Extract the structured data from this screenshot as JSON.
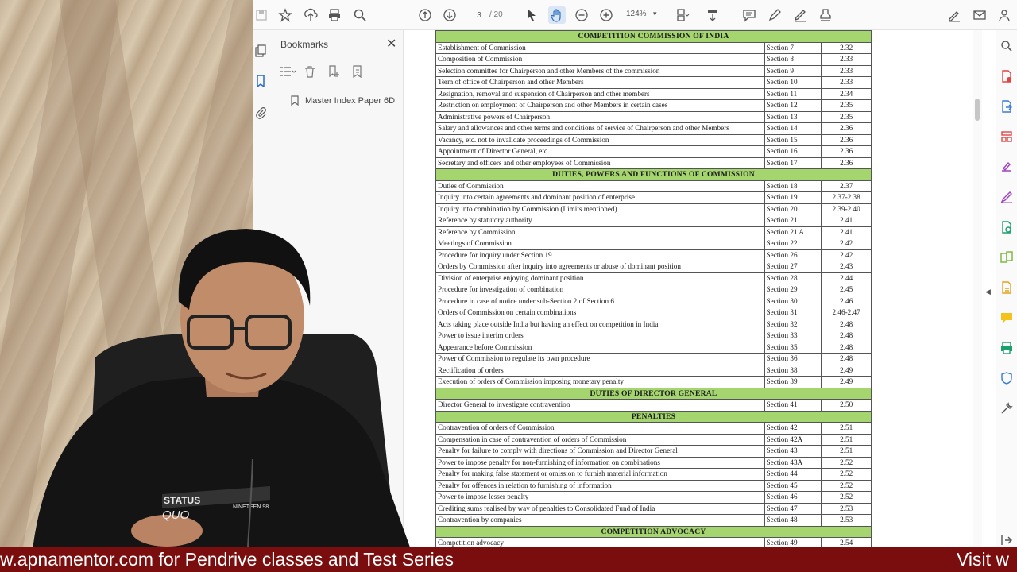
{
  "toolbar": {
    "page_current": "3",
    "page_total": "/ 20",
    "zoom": "124%"
  },
  "bookmarks": {
    "title": "Bookmarks",
    "close": "✕",
    "item": "Master Index Paper 6D"
  },
  "index": {
    "rows": [
      {
        "type": "head",
        "title": "COMPETITION COMMISSION OF INDIA"
      },
      {
        "topic": "Establishment of Commission",
        "section": "Section 7",
        "page": "2.32"
      },
      {
        "topic": "Composition of Commission",
        "section": "Section 8",
        "page": "2.33"
      },
      {
        "topic": "Selection committee for Chairperson and other Members of the commission",
        "section": "Section 9",
        "page": "2.33"
      },
      {
        "topic": "Term of office of Chairperson and other Members",
        "section": "Section 10",
        "page": "2.33"
      },
      {
        "topic": "Resignation, removal and suspension of Chairperson and other members",
        "section": "Section 11",
        "page": "2.34"
      },
      {
        "topic": "Restriction on employment of Chairperson and other Members in certain cases",
        "section": "Section 12",
        "page": "2.35"
      },
      {
        "topic": "Administrative powers of Chairperson",
        "section": "Section 13",
        "page": "2.35"
      },
      {
        "topic": "Salary and allowances and other terms and conditions of service of Chairperson and other Members",
        "section": "Section 14",
        "page": "2.36"
      },
      {
        "topic": "Vacancy, etc. not to invalidate proceedings of Commission",
        "section": "Section 15",
        "page": "2.36"
      },
      {
        "topic": "Appointment of Director General, etc.",
        "section": "Section 16",
        "page": "2.36"
      },
      {
        "topic": "Secretary and officers and other employees of Commission",
        "section": "Section 17",
        "page": "2.36"
      },
      {
        "type": "head",
        "title": "DUTIES, POWERS AND FUNCTIONS OF COMMISSION"
      },
      {
        "topic": "Duties of Commission",
        "section": "Section 18",
        "page": "2.37"
      },
      {
        "topic": "Inquiry into certain agreements and dominant position of enterprise",
        "section": "Section 19",
        "page": "2.37-2.38"
      },
      {
        "topic": "Inquiry into combination by Commission (Limits mentioned)",
        "section": "Section 20",
        "page": "2.39-2.40"
      },
      {
        "topic": "Reference by statutory authority",
        "section": "Section 21",
        "page": "2.41"
      },
      {
        "topic": "Reference by Commission",
        "section": "Section 21 A",
        "page": "2.41"
      },
      {
        "topic": "Meetings of Commission",
        "section": "Section 22",
        "page": "2.42"
      },
      {
        "topic": "Procedure for inquiry under Section 19",
        "section": "Section 26",
        "page": "2.42"
      },
      {
        "topic": "Orders by Commission after inquiry into agreements or abuse of dominant position",
        "section": "Section 27",
        "page": "2.43"
      },
      {
        "topic": "Division of enterprise enjoying dominant position",
        "section": "Section 28",
        "page": "2.44"
      },
      {
        "topic": "Procedure for investigation of combination",
        "section": "Section 29",
        "page": "2.45"
      },
      {
        "topic": "Procedure in case of notice under sub-Section 2 of Section 6",
        "section": "Section 30",
        "page": "2.46"
      },
      {
        "topic": "Orders of Commission on certain combinations",
        "section": "Section 31",
        "page": "2.46-2.47"
      },
      {
        "topic": "Acts taking place outside India but having an effect on competition in India",
        "section": "Section 32",
        "page": "2.48"
      },
      {
        "topic": "Power to issue interim orders",
        "section": "Section 33",
        "page": "2.48"
      },
      {
        "topic": "Appearance before Commission",
        "section": "Section 35",
        "page": "2.48"
      },
      {
        "topic": "Power of Commission to regulate its own procedure",
        "section": "Section 36",
        "page": "2.48"
      },
      {
        "topic": "Rectification of orders",
        "section": "Section 38",
        "page": "2.49"
      },
      {
        "topic": "Execution of orders of Commission imposing monetary penalty",
        "section": "Section 39",
        "page": "2.49"
      },
      {
        "type": "head",
        "title": "DUTIES OF DIRECTOR GENERAL"
      },
      {
        "topic": "Director General to investigate contravention",
        "section": "Section 41",
        "page": "2.50"
      },
      {
        "type": "head",
        "title": "PENALTIES"
      },
      {
        "topic": "Contravention of orders of Commission",
        "section": "Section 42",
        "page": "2.51"
      },
      {
        "topic": "Compensation in case of contravention of orders of Commission",
        "section": "Section 42A",
        "page": "2.51"
      },
      {
        "topic": "Penalty for failure to comply with directions of Commission and Director General",
        "section": "Section 43",
        "page": "2.51"
      },
      {
        "topic": "Power to impose penalty for non-furnishing of information on combinations",
        "section": "Section 43A",
        "page": "2.52"
      },
      {
        "topic": "Penalty for making false statement or omission to furnish material information",
        "section": "Section 44",
        "page": "2.52"
      },
      {
        "topic": "Penalty for offences in relation to furnishing of information",
        "section": "Section 45",
        "page": "2.52"
      },
      {
        "topic": "Power to impose lesser penalty",
        "section": "Section 46",
        "page": "2.52"
      },
      {
        "topic": "Crediting sums realised by way of penalties to Consolidated Fund of India",
        "section": "Section 47",
        "page": "2.53"
      },
      {
        "topic": "Contravention by companies",
        "section": "Section 48",
        "page": "2.53"
      },
      {
        "type": "head",
        "title": "COMPETITION ADVOCACY"
      },
      {
        "topic": "Competition advocacy",
        "section": "Section 49",
        "page": "2.54"
      }
    ]
  },
  "shirt": {
    "line1": "STATUS",
    "line2": "QUO",
    "line3": "NINETEEN 98"
  },
  "ticker": {
    "text": "w.apnamentor.com for Pendrive classes and Test Series",
    "text2": "Visit w"
  },
  "colors": {
    "section_header": "#a4d56e",
    "ticker": "#7a0d0d"
  }
}
